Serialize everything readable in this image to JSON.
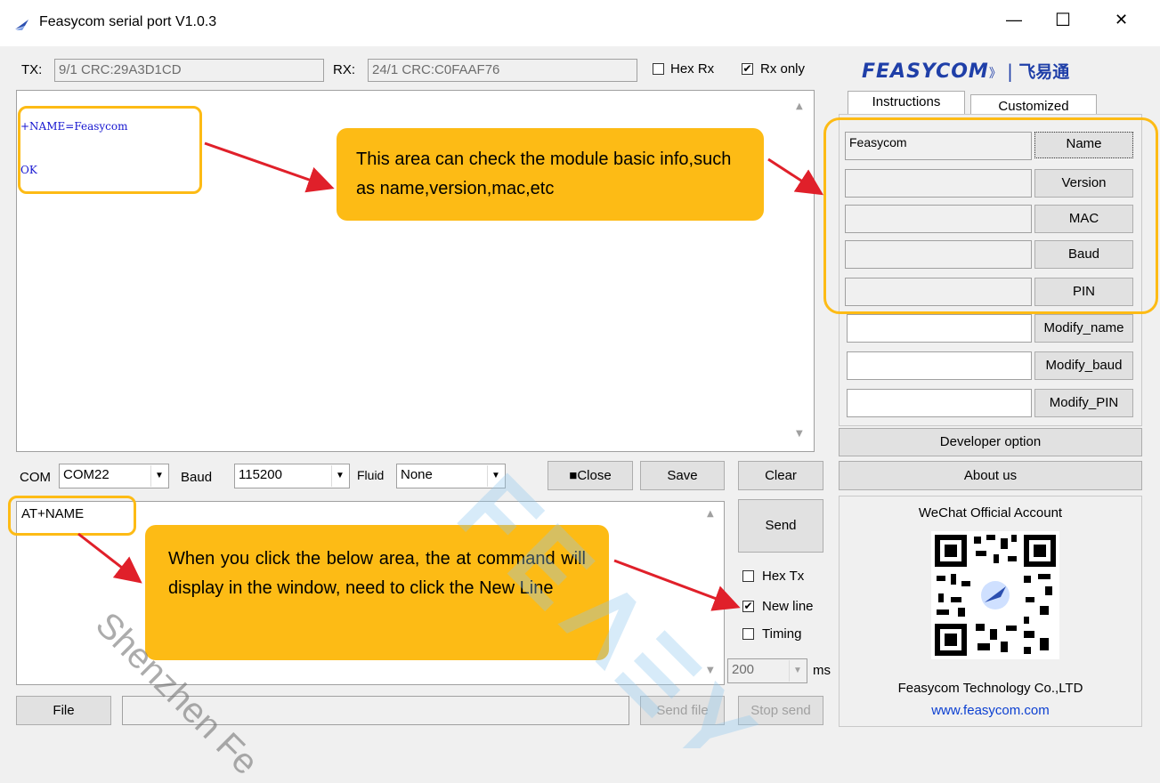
{
  "window": {
    "title": "Feasycom serial port V1.0.3",
    "minimize": "—",
    "maximize": "☐",
    "close": "✕"
  },
  "topbar": {
    "tx_label": "TX:",
    "tx_value": "9/1 CRC:29A3D1CD",
    "rx_label": "RX:",
    "rx_value": "24/1 CRC:C0FAAF76",
    "hex_rx": "Hex Rx",
    "rx_only": "Rx only",
    "hex_rx_checked": false,
    "rx_only_checked": true
  },
  "logo": {
    "brand": "FEASYCOM",
    "mark": "》",
    "chinese": "飞易通"
  },
  "receive": {
    "line1": "+NAME=Feasycom",
    "line2": "OK"
  },
  "callouts": {
    "info_area": "This area can check the module basic info,such as name,version,mac,etc",
    "send_area": "When you click the below area, the at command will display in the window, need to click the New Line"
  },
  "tabs": {
    "instructions": "Instructions",
    "customized": "Customized"
  },
  "instructions": {
    "rows": [
      {
        "value": "Feasycom",
        "button": "Name"
      },
      {
        "value": "",
        "button": "Version"
      },
      {
        "value": "",
        "button": "MAC"
      },
      {
        "value": "",
        "button": "Baud"
      },
      {
        "value": "",
        "button": "PIN"
      }
    ],
    "modify_rows": [
      {
        "value": "",
        "button": "Modify_name"
      },
      {
        "value": "",
        "button": "Modify_baud"
      },
      {
        "value": "",
        "button": "Modify_PIN"
      }
    ],
    "developer_option": "Developer option",
    "about_us": "About us"
  },
  "port_bar": {
    "com_label": "COM",
    "com_value": "COM22",
    "baud_label": "Baud",
    "baud_value": "115200",
    "fluid_label": "Fluid",
    "fluid_value": "None",
    "close_button": "■Close",
    "save_button": "Save",
    "clear_button": "Clear"
  },
  "send": {
    "input_text": "AT+NAME",
    "send_button": "Send",
    "hex_tx": "Hex Tx",
    "new_line": "New line",
    "timing": "Timing",
    "hex_tx_checked": false,
    "new_line_checked": true,
    "timing_checked": false,
    "interval_value": "200",
    "interval_unit": "ms"
  },
  "file_bar": {
    "file_button": "File",
    "file_path": "",
    "send_file_button": "Send file",
    "stop_send_button": "Stop send"
  },
  "wechat": {
    "title": "WeChat Official Account",
    "company": "Feasycom Technology Co.,LTD",
    "website": "www.feasycom.com"
  },
  "watermark": {
    "text": "Shenzhen Fe"
  },
  "colors": {
    "accent_orange": "#fdbb15",
    "arrow_red": "#e0202a",
    "logo_blue": "#1f3fa8",
    "link_blue": "#0b3fd1",
    "receive_text_blue": "#1616d0"
  }
}
